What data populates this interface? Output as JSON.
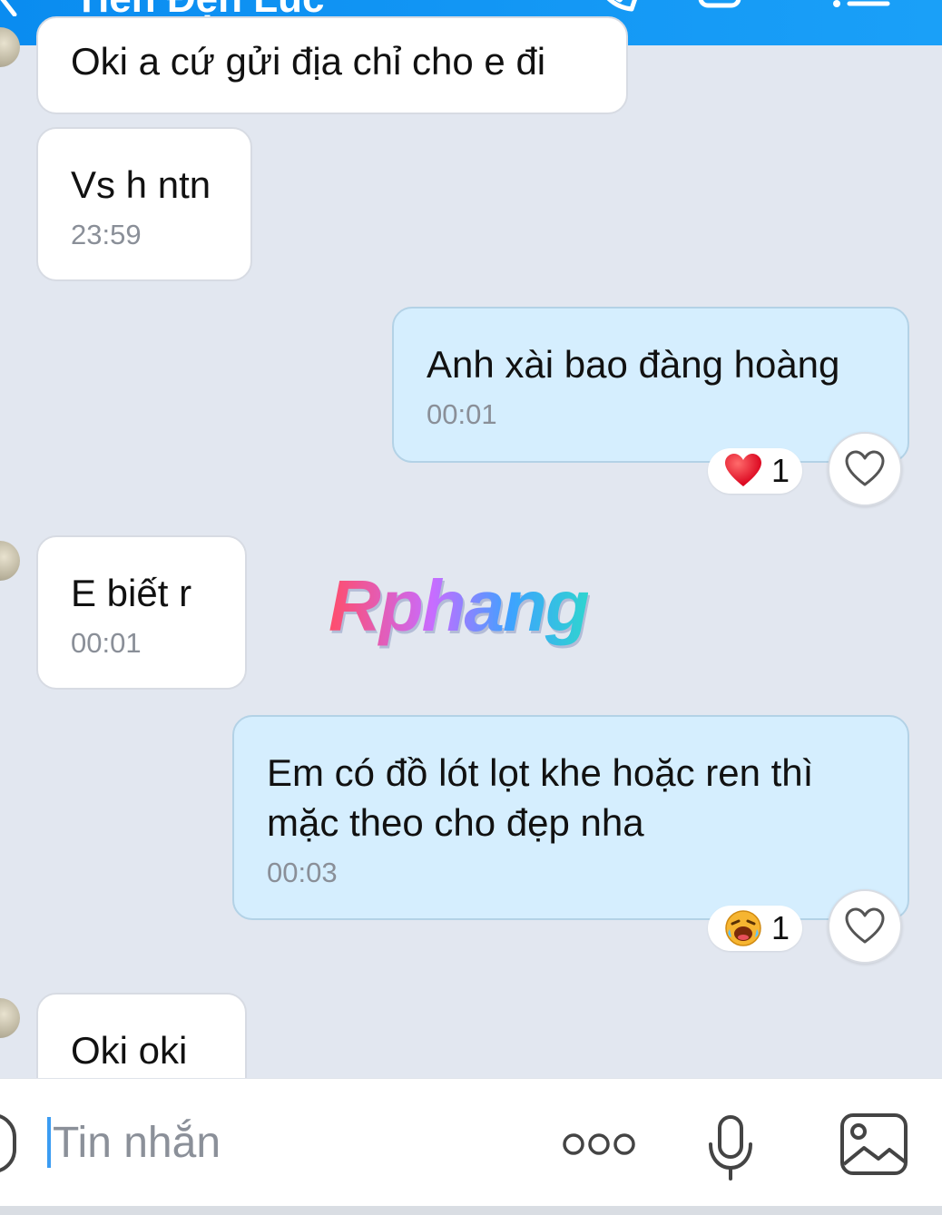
{
  "header": {
    "title": "Tiến Đẹn Lúc",
    "icons": [
      "back-icon",
      "phone-icon",
      "video-icon",
      "menu-icon"
    ]
  },
  "messages": [
    {
      "direction": "in",
      "text": "Oki a cứ gửi địa chỉ cho e đi",
      "time": ""
    },
    {
      "direction": "in",
      "text": "Vs h ntn",
      "time": "23:59"
    },
    {
      "direction": "out",
      "text": "Anh xài bao đàng hoàng",
      "time": "00:01",
      "reaction": {
        "emoji": "heart",
        "count": "1"
      }
    },
    {
      "direction": "in",
      "text": "E biết r",
      "time": "00:01"
    },
    {
      "direction": "out",
      "text": "Em có đồ lót lọt khe hoặc ren thì\nmặc theo cho đẹp nha",
      "time": "00:03",
      "reaction": {
        "emoji": "laughing-face",
        "count": "1"
      }
    },
    {
      "direction": "in",
      "text": "Oki oki",
      "time": ""
    }
  ],
  "watermark": "Rphang",
  "composer": {
    "placeholder": "Tin nhắn",
    "icons": [
      "sticker-icon",
      "more-options-icon",
      "microphone-icon",
      "image-icon"
    ]
  },
  "colors": {
    "header": "#1a96f5",
    "background": "#e2e7f0",
    "outgoing_bubble": "#d5eefe",
    "incoming_bubble": "#ffffff",
    "caret": "#3b9cf2"
  }
}
